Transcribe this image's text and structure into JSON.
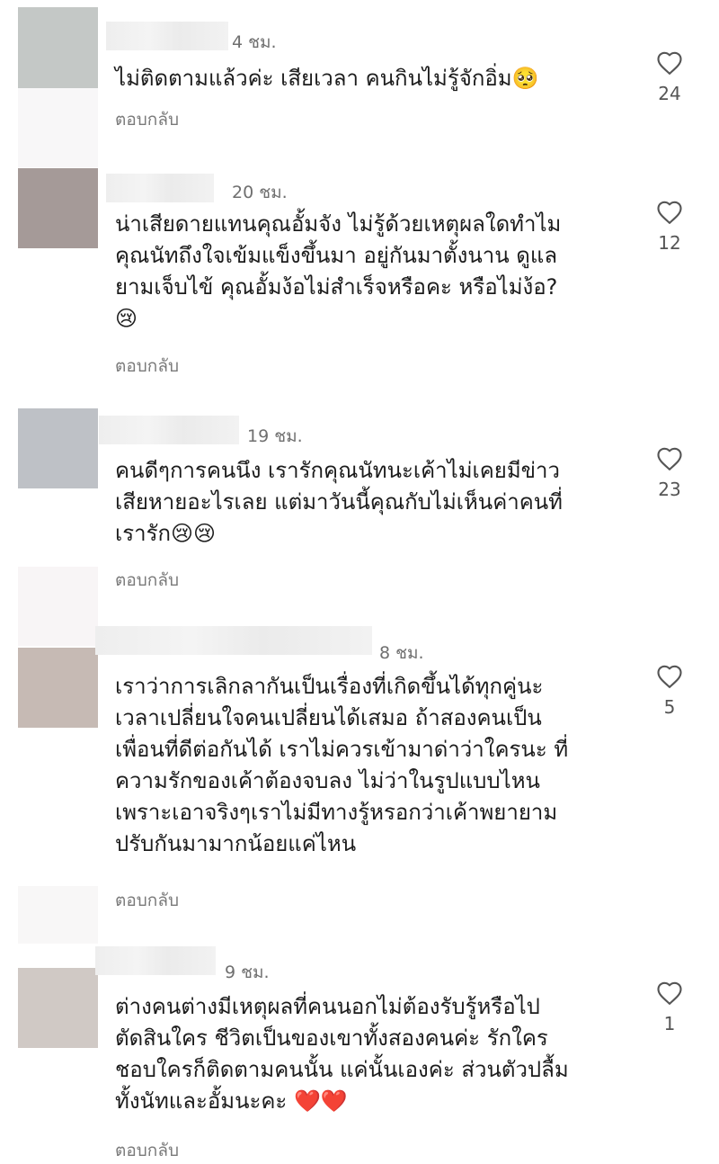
{
  "comments": [
    {
      "time": "4 ชม.",
      "text": "ไม่ติดตามแล้วค่ะ เสียเวลา คนกินไม่รู้จักอิ่ม🥺",
      "reply_label": "ตอบกลับ",
      "likes": "24",
      "avatar_color": "#c4c8c6"
    },
    {
      "time": "20 ชม.",
      "text": "น่าเสียดายแทนคุณอั้มจัง ไม่รู้ด้วยเหตุผลใดทำไม\nคุณนัทถึงใจเข้มแข็งขึ้นมา อยู่กันมาตั้งนาน ดูแล\nยามเจ็บไข้ คุณอั้มง้อไม่สำเร็จหรือคะ หรือไม่ง้อ?\n😢",
      "reply_label": "ตอบกลับ",
      "likes": "12",
      "avatar_color": "#a59a98"
    },
    {
      "time": "19 ชม.",
      "text": "คนดีๆการคนนึง เรารักคุณนัทนะเค้าไม่เคยมีข่าว\nเสียหายอะไรเลย แต่มาวันนี้คุณกับไม่เห็นค่าคนที่\nเรารัก😢😢",
      "reply_label": "ตอบกลับ",
      "likes": "23",
      "avatar_color": "#bec1c6"
    },
    {
      "time": "8 ชม.",
      "text": "เราว่าการเลิกลากันเป็นเรื่องที่เกิดขึ้นได้ทุกคู่นะ\nเวลาเปลี่ยนใจคนเปลี่ยนได้เสมอ ถ้าสองคนเป็น\nเพื่อนที่ดีต่อกันได้ เราไม่ควรเข้ามาด่าว่าใครนะ ที่\nความรักของเค้าต้องจบลง ไม่ว่าในรูปแบบไหน\nเพราะเอาจริงๆเราไม่มีทางรู้หรอกว่าเค้าพยายาม\nปรับกันมามากน้อยแค่ไหน",
      "reply_label": "ตอบกลับ",
      "likes": "5",
      "avatar_color": "#c6bab4"
    },
    {
      "time": "9 ชม.",
      "text": "ต่างคนต่างมีเหตุผลที่คนนอกไม่ต้องรับรู้หรือไป\nตัดสินใคร ชีวิตเป็นของเขาทั้งสองคนค่ะ รักใคร\nชอบใครก็ติดตามคนนั้น แค่นั้นเองค่ะ ส่วนตัวปลื้ม\nทั้งนัทและอั้มนะคะ ❤️❤️",
      "reply_label": "ตอบกลับ",
      "likes": "1",
      "avatar_color": "#d0c9c5"
    }
  ]
}
